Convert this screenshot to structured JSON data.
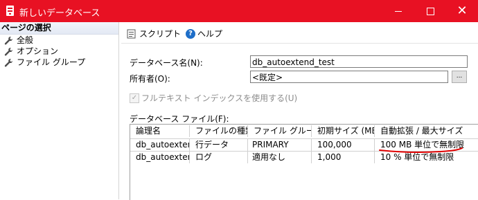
{
  "window": {
    "title": "新しいデータベース"
  },
  "sidebar": {
    "header": "ページの選択",
    "items": [
      {
        "label": "全般"
      },
      {
        "label": "オプション"
      },
      {
        "label": "ファイル グループ"
      }
    ]
  },
  "toolbar": {
    "script_label": "スクリプト",
    "help_label": "ヘルプ"
  },
  "form": {
    "db_name_label": "データベース名(N):",
    "db_name_value": "db_autoextend_test",
    "owner_label": "所有者(O):",
    "owner_value": "<既定>",
    "owner_browse_label": "...",
    "fulltext_label": "フルテキスト インデックスを使用する(U)",
    "db_files_label": "データベース ファイル(F):"
  },
  "grid": {
    "headers": [
      "論理名",
      "ファイルの種類",
      "ファイル グループ",
      "初期サイズ (MB)",
      "自動拡張 / 最大サイズ"
    ],
    "rows": [
      [
        "db_autoexten…",
        "行データ",
        "PRIMARY",
        "100,000",
        "100 MB 単位で無制限"
      ],
      [
        "db_autoexten…",
        "ログ",
        "適用なし",
        "1,000",
        "10 % 単位で無制限"
      ]
    ]
  },
  "colors": {
    "titlebar": "#e81123",
    "annotation": "#e00000"
  }
}
